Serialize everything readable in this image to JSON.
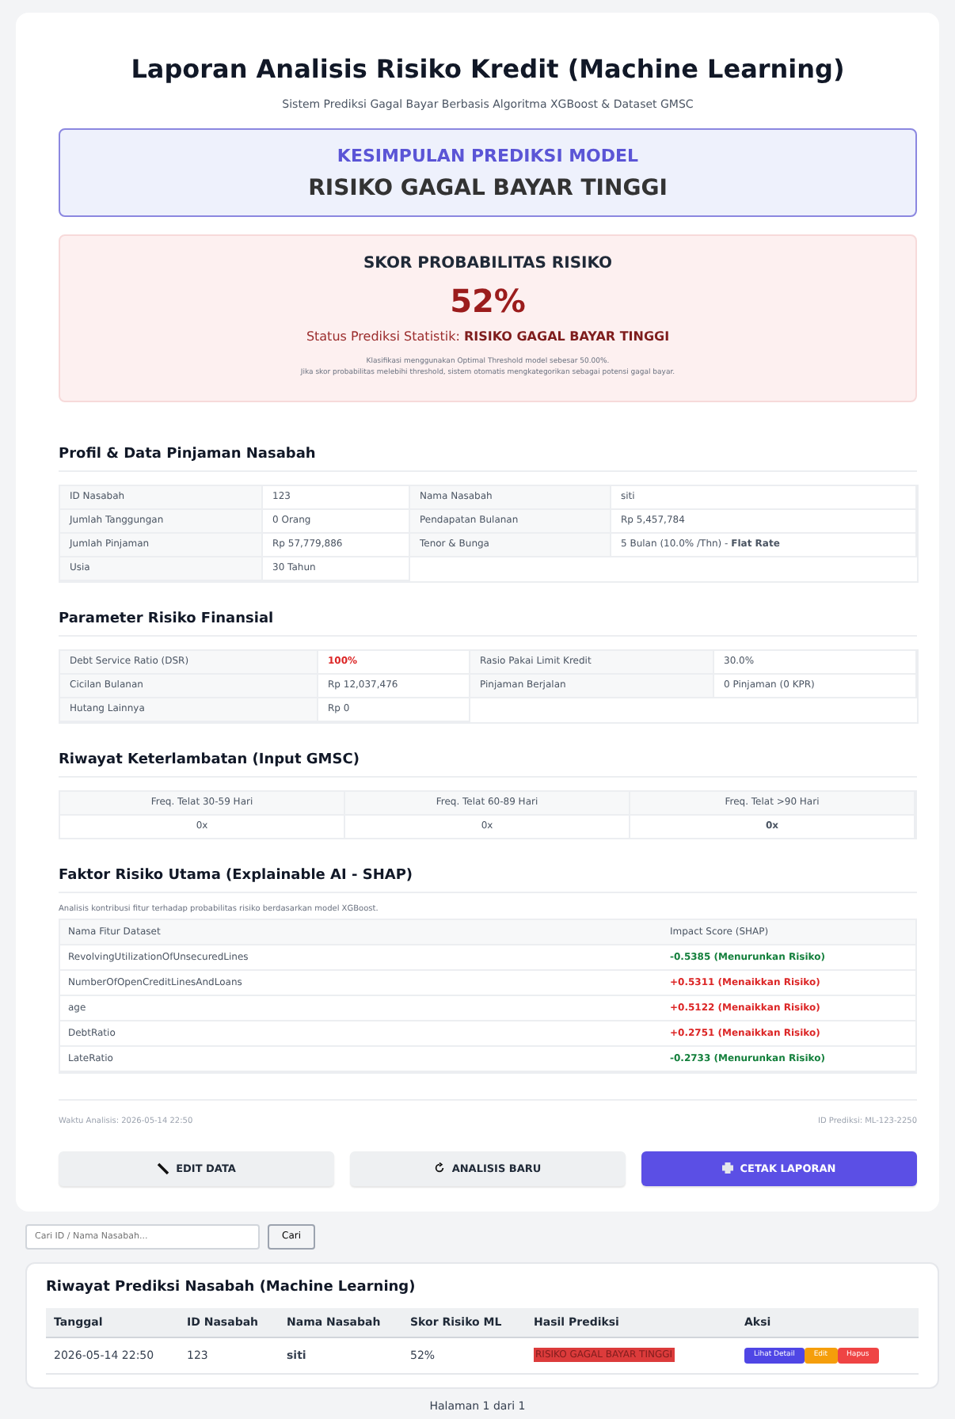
{
  "header": {
    "title": "Laporan Analisis Risiko Kredit (Machine Learning)",
    "subtitle": "Sistem Prediksi Gagal Bayar Berbasis Algoritma XGBoost & Dataset GMSC"
  },
  "conclusion": {
    "label": "KESIMPULAN PREDIKSI MODEL",
    "result": "RISIKO GAGAL BAYAR TINGGI"
  },
  "score": {
    "title": "SKOR PROBABILITAS RISIKO",
    "value": "52%",
    "status_label": "Status Prediksi Statistik:",
    "status_value": "RISIKO GAGAL BAYAR TINGGI",
    "notes": [
      "Klasifikasi menggunakan Optimal Threshold model sebesar 50.00%.",
      "Jika skor probabilitas melebihi threshold, sistem otomatis mengkategorikan sebagai potensi gagal bayar."
    ]
  },
  "profile": {
    "title": "Profil & Data Pinjaman Nasabah",
    "rows": [
      [
        {
          "label": "ID Nasabah",
          "value": "123"
        },
        {
          "label": "Nama Nasabah",
          "value": "siti"
        }
      ],
      [
        {
          "label": "Jumlah Tanggungan",
          "value": "0 Orang"
        },
        {
          "label": "Pendapatan Bulanan",
          "value": "Rp 5,457,784"
        }
      ],
      [
        {
          "label": "Jumlah Pinjaman",
          "value": "Rp 57,779,886"
        },
        {
          "label": "Tenor & Bunga",
          "value": "5 Bulan (10.0% /Thn) - **Flat Rate**"
        }
      ],
      [
        {
          "label": "Usia",
          "value": "30 Tahun"
        }
      ]
    ]
  },
  "parameters": {
    "title": "Parameter Risiko Finansial",
    "rows": [
      [
        {
          "label": "Debt Service Ratio (DSR)",
          "value": "100%",
          "danger": true
        },
        {
          "label": "Rasio Pakai Limit Kredit",
          "value": "30.0%",
          "danger": false
        }
      ],
      [
        {
          "label": "Cicilan Bulanan",
          "value": "Rp 12,037,476",
          "danger": false
        },
        {
          "label": "Pinjaman Berjalan",
          "value": "0 Pinjaman (0 KPR)",
          "danger": false
        }
      ],
      [
        {
          "label": "Hutang Lainnya",
          "value": "Rp 0",
          "danger": false
        }
      ]
    ]
  },
  "late_history": {
    "title": "Riwayat Keterlambatan (Input GMSC)",
    "columns": [
      {
        "header": "Freq. Telat 30-59 Hari",
        "value": "0x",
        "bold": false
      },
      {
        "header": "Freq. Telat 60-89 Hari",
        "value": "0x",
        "bold": false
      },
      {
        "header": "Freq. Telat >90 Hari",
        "value": "0x",
        "bold": true
      }
    ]
  },
  "shap": {
    "title": "Faktor Risiko Utama (Explainable AI - SHAP)",
    "note": "Analisis kontribusi fitur terhadap probabilitas risiko berdasarkan model XGBoost.",
    "columns": [
      "Nama Fitur Dataset",
      "Impact Score (SHAP)"
    ],
    "rows": [
      {
        "feature": "RevolvingUtilizationOfUnsecuredLines",
        "impact": "-0.5385 (Menurunkan Risiko)",
        "kind": "decrease"
      },
      {
        "feature": "NumberOfOpenCreditLinesAndLoans",
        "impact": "+0.5311 (Menaikkan Risiko)",
        "kind": "increase"
      },
      {
        "feature": "age",
        "impact": "+0.5122 (Menaikkan Risiko)",
        "kind": "increase"
      },
      {
        "feature": "DebtRatio",
        "impact": "+0.2751 (Menaikkan Risiko)",
        "kind": "increase"
      },
      {
        "feature": "LateRatio",
        "impact": "-0.2733 (Menurunkan Risiko)",
        "kind": "decrease"
      }
    ]
  },
  "footer": {
    "time": "Waktu Analisis: 2026-05-14 22:50",
    "id": "ID Prediksi: ML-123-2250"
  },
  "actions": [
    {
      "label": "EDIT DATA",
      "kind": "secondary"
    },
    {
      "label": "ANALISIS BARU",
      "kind": "secondary"
    },
    {
      "label": "CETAK LAPORAN",
      "kind": "primary"
    }
  ],
  "search": {
    "placeholder": "Cari ID / Nama Nasabah...",
    "button": "Cari"
  },
  "history": {
    "title": "Riwayat Prediksi Nasabah (Machine Learning)",
    "columns": [
      "Tanggal",
      "ID Nasabah",
      "Nama Nasabah",
      "Skor Risiko ML",
      "Hasil Prediksi",
      "Aksi"
    ],
    "rows": [
      {
        "date": "2026-05-14 22:50",
        "id": "123",
        "name": "siti",
        "score": "52%",
        "result": "RISIKO GAGAL BAYAR TINGGI",
        "actions": [
          {
            "label": "Lihat Detail",
            "kind": "view"
          },
          {
            "label": "Edit",
            "kind": "edit"
          },
          {
            "label": "Hapus",
            "kind": "delete"
          }
        ]
      }
    ]
  },
  "pagination": "Halaman 1 dari 1"
}
